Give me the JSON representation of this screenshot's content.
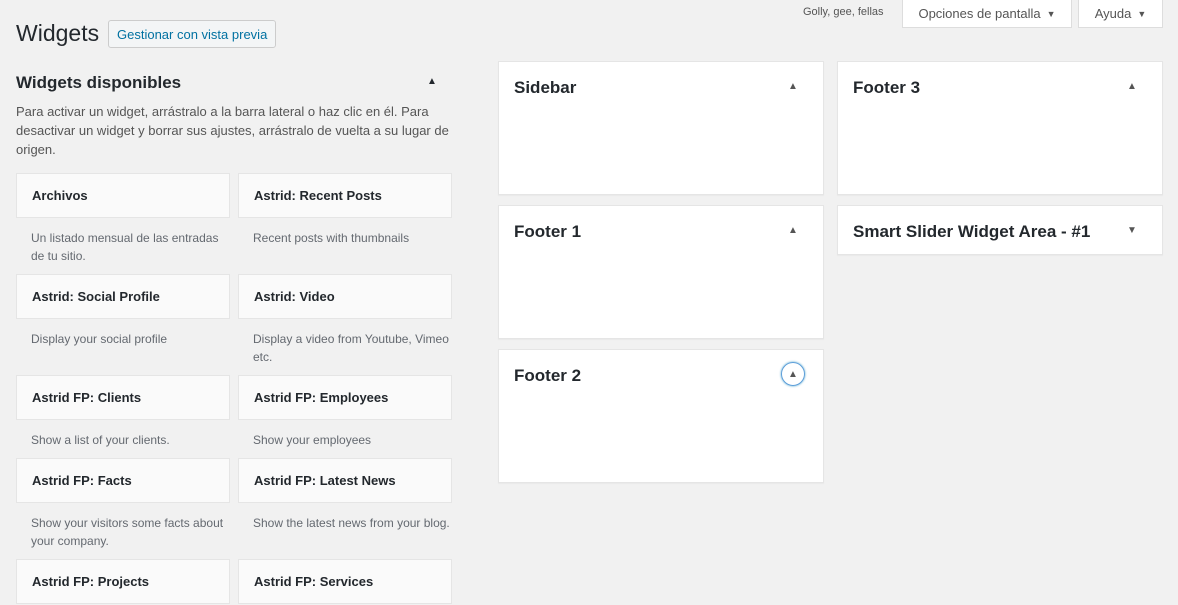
{
  "header": {
    "greeting": "Golly, gee, fellas",
    "screen_options": "Opciones de pantalla",
    "help": "Ayuda",
    "page_title": "Widgets",
    "preview_button": "Gestionar con vista previa"
  },
  "available": {
    "title": "Widgets disponibles",
    "description": "Para activar un widget, arrástralo a la barra lateral o haz clic en él. Para desactivar un widget y borrar sus ajustes, arrástralo de vuelta a su lugar de origen.",
    "widgets": [
      {
        "name": "Archivos",
        "desc": "Un listado mensual de las entradas de tu sitio."
      },
      {
        "name": "Astrid: Recent Posts",
        "desc": "Recent posts with thumbnails"
      },
      {
        "name": "Astrid: Social Profile",
        "desc": "Display your social profile"
      },
      {
        "name": "Astrid: Video",
        "desc": "Display a video from Youtube, Vimeo etc."
      },
      {
        "name": "Astrid FP: Clients",
        "desc": "Show a list of your clients."
      },
      {
        "name": "Astrid FP: Employees",
        "desc": "Show your employees"
      },
      {
        "name": "Astrid FP: Facts",
        "desc": "Show your visitors some facts about your company."
      },
      {
        "name": "Astrid FP: Latest News",
        "desc": "Show the latest news from your blog."
      },
      {
        "name": "Astrid FP: Projects",
        "desc": ""
      },
      {
        "name": "Astrid FP: Services",
        "desc": ""
      }
    ]
  },
  "sidebars": {
    "sidebar": "Sidebar",
    "footer1": "Footer 1",
    "footer2": "Footer 2",
    "footer3": "Footer 3",
    "smart_slider": "Smart Slider Widget Area - #1"
  },
  "icons": {
    "collapse": "triangle-up-icon",
    "expand": "triangle-down-icon"
  },
  "colors": {
    "accent": "#0071a1",
    "focus_ring": "#5b9dd9",
    "background": "#f1f1f1"
  }
}
